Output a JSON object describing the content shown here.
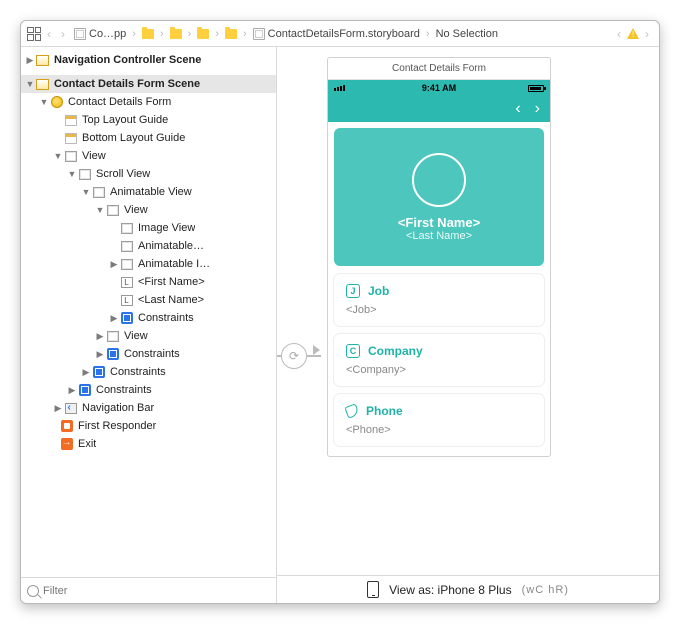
{
  "jumpbar": {
    "items": [
      {
        "kind": "app",
        "label": "Co…pp"
      },
      {
        "kind": "folder",
        "label": ""
      },
      {
        "kind": "folder",
        "label": ""
      },
      {
        "kind": "folder",
        "label": ""
      },
      {
        "kind": "folder",
        "label": ""
      },
      {
        "kind": "storyboard",
        "label": "ContactDetailsForm.storyboard"
      },
      {
        "kind": "selection",
        "label": "No Selection"
      }
    ]
  },
  "outline": {
    "scenes": [
      {
        "label": "Navigation Controller Scene",
        "expanded": false,
        "selected": false
      },
      {
        "label": "Contact Details Form Scene",
        "expanded": true,
        "selected": true,
        "children": [
          {
            "icon": "vc",
            "label": "Contact Details Form",
            "expanded": true,
            "children": [
              {
                "icon": "guide",
                "label": "Top Layout Guide"
              },
              {
                "icon": "guide",
                "label": "Bottom Layout Guide"
              },
              {
                "icon": "view",
                "label": "View",
                "expanded": true,
                "children": [
                  {
                    "icon": "view",
                    "label": "Scroll View",
                    "expanded": true,
                    "children": [
                      {
                        "icon": "view",
                        "label": "Animatable View",
                        "expanded": true,
                        "children": [
                          {
                            "icon": "view",
                            "label": "View",
                            "expanded": true,
                            "children": [
                              {
                                "icon": "view",
                                "label": "Image View"
                              },
                              {
                                "icon": "view",
                                "label": "Animatable…"
                              },
                              {
                                "icon": "view",
                                "label": "Animatable I…",
                                "collapsible": true
                              },
                              {
                                "icon": "label",
                                "label": "<First Name>"
                              },
                              {
                                "icon": "label",
                                "label": "<Last Name>"
                              },
                              {
                                "icon": "cons",
                                "label": "Constraints",
                                "collapsible": true
                              }
                            ]
                          },
                          {
                            "icon": "view",
                            "label": "View",
                            "collapsible": true
                          },
                          {
                            "icon": "cons",
                            "label": "Constraints",
                            "collapsible": true
                          }
                        ]
                      },
                      {
                        "icon": "cons",
                        "label": "Constraints",
                        "collapsible": true
                      }
                    ]
                  },
                  {
                    "icon": "cons",
                    "label": "Constraints",
                    "collapsible": true
                  }
                ]
              },
              {
                "icon": "nav",
                "label": "Navigation Bar",
                "collapsible": true
              }
            ]
          },
          {
            "icon": "fr",
            "label": "First Responder"
          },
          {
            "icon": "exit",
            "label": "Exit"
          }
        ]
      }
    ],
    "filter_placeholder": "Filter"
  },
  "preview": {
    "scene_title": "Contact Details Form",
    "status_time": "9:41 AM",
    "first_name": "<First Name>",
    "last_name": "<Last Name>",
    "fields": [
      {
        "title": "Job",
        "value": "<Job>",
        "icon": "J"
      },
      {
        "title": "Company",
        "value": "<Company>",
        "icon": "C"
      },
      {
        "title": "Phone",
        "value": "<Phone>",
        "icon": "phone"
      }
    ]
  },
  "view_as": {
    "label": "View as: iPhone 8 Plus",
    "traits": "(wC hR)"
  }
}
